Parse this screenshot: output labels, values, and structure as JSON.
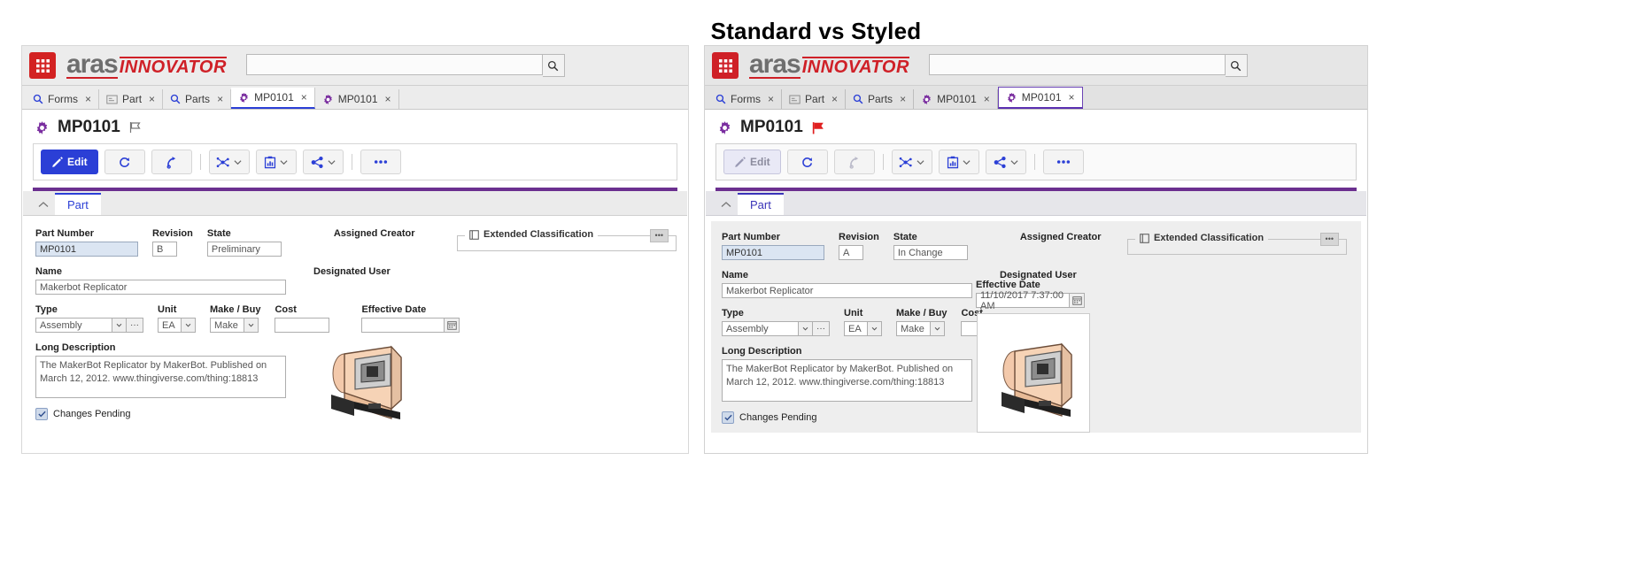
{
  "page": {
    "title": "Standard vs Styled"
  },
  "panels": [
    {
      "id": "standard",
      "brand": {
        "aras": "aras",
        "innovator": "INNOVATOR"
      },
      "search": {
        "value": "",
        "placeholder": ""
      },
      "tabs": [
        {
          "label": "Forms",
          "icon": "search-icon",
          "close": "×",
          "active": false
        },
        {
          "label": "Part",
          "icon": "form-icon",
          "close": "×",
          "active": false
        },
        {
          "label": "Parts",
          "icon": "search-icon",
          "close": "×",
          "active": false
        },
        {
          "label": "MP0101",
          "icon": "gear-icon",
          "close": "×",
          "active": true
        },
        {
          "label": "MP0101",
          "icon": "gear-icon",
          "close": "×",
          "active": false
        }
      ],
      "item": {
        "title": "MP0101",
        "flag": "outline-flag-icon"
      },
      "toolbar": {
        "edit_label": "Edit",
        "buttons": [
          "edit",
          "refresh",
          "redo",
          "structure",
          "report",
          "share",
          "more"
        ],
        "more_label": "•••"
      },
      "section_tab": "Part",
      "fields": {
        "part_number": {
          "label": "Part Number",
          "value": "MP0101"
        },
        "revision": {
          "label": "Revision",
          "value": "B"
        },
        "state": {
          "label": "State",
          "value": "Preliminary"
        },
        "assigned_creator": {
          "label": "Assigned Creator",
          "value": ""
        },
        "name": {
          "label": "Name",
          "value": "Makerbot Replicator"
        },
        "designated_user": {
          "label": "Designated User",
          "value": ""
        },
        "type": {
          "label": "Type",
          "value": "Assembly"
        },
        "unit": {
          "label": "Unit",
          "value": "EA"
        },
        "make_buy": {
          "label": "Make / Buy",
          "value": "Make"
        },
        "cost": {
          "label": "Cost",
          "value": ""
        },
        "effective_date": {
          "label": "Effective Date",
          "value": ""
        },
        "long_description": {
          "label": "Long Description",
          "value": "The MakerBot Replicator by MakerBot. Published on March 12, 2012. www.thingiverse.com/thing:18813"
        },
        "changes_pending": {
          "label": "Changes Pending",
          "checked": true
        }
      },
      "extended_classification": {
        "label": "Extended Classification",
        "menu": "•••"
      }
    },
    {
      "id": "styled",
      "brand": {
        "aras": "aras",
        "innovator": "INNOVATOR"
      },
      "search": {
        "value": "",
        "placeholder": ""
      },
      "tabs": [
        {
          "label": "Forms",
          "icon": "search-icon",
          "close": "×",
          "active": false
        },
        {
          "label": "Part",
          "icon": "form-icon",
          "close": "×",
          "active": false
        },
        {
          "label": "Parts",
          "icon": "search-icon",
          "close": "×",
          "active": false
        },
        {
          "label": "MP0101",
          "icon": "gear-icon",
          "close": "×",
          "active": false
        },
        {
          "label": "MP0101",
          "icon": "gear-icon",
          "close": "×",
          "active": true
        }
      ],
      "item": {
        "title": "MP0101",
        "flag": "red-flag-icon"
      },
      "toolbar": {
        "edit_label": "Edit",
        "buttons": [
          "edit",
          "refresh",
          "redo",
          "structure",
          "report",
          "share",
          "more"
        ],
        "more_label": "•••"
      },
      "section_tab": "Part",
      "fields": {
        "part_number": {
          "label": "Part Number",
          "value": "MP0101"
        },
        "revision": {
          "label": "Revision",
          "value": "A"
        },
        "state": {
          "label": "State",
          "value": "In Change"
        },
        "assigned_creator": {
          "label": "Assigned Creator",
          "value": ""
        },
        "name": {
          "label": "Name",
          "value": "Makerbot Replicator"
        },
        "designated_user": {
          "label": "Designated User",
          "value": ""
        },
        "type": {
          "label": "Type",
          "value": "Assembly"
        },
        "unit": {
          "label": "Unit",
          "value": "EA"
        },
        "make_buy": {
          "label": "Make / Buy",
          "value": "Make"
        },
        "cost": {
          "label": "Cost",
          "value": ""
        },
        "effective_date": {
          "label": "Effective Date",
          "value": "11/10/2017 7:37:00 AM"
        },
        "long_description": {
          "label": "Long Description",
          "value": "The MakerBot Replicator by MakerBot. Published on March 12, 2012. www.thingiverse.com/thing:18813"
        },
        "changes_pending": {
          "label": "Changes Pending",
          "checked": true
        }
      },
      "extended_classification": {
        "label": "Extended Classification",
        "menu": "•••"
      }
    }
  ],
  "colors": {
    "brand_red": "#cf2027",
    "accent_purple": "#6b2f8f",
    "primary_blue": "#2b3fd6",
    "tab_active_blue": "#2b3fd6",
    "key_field_blue": "#dbe5f2",
    "flag_red": "#e02020"
  }
}
